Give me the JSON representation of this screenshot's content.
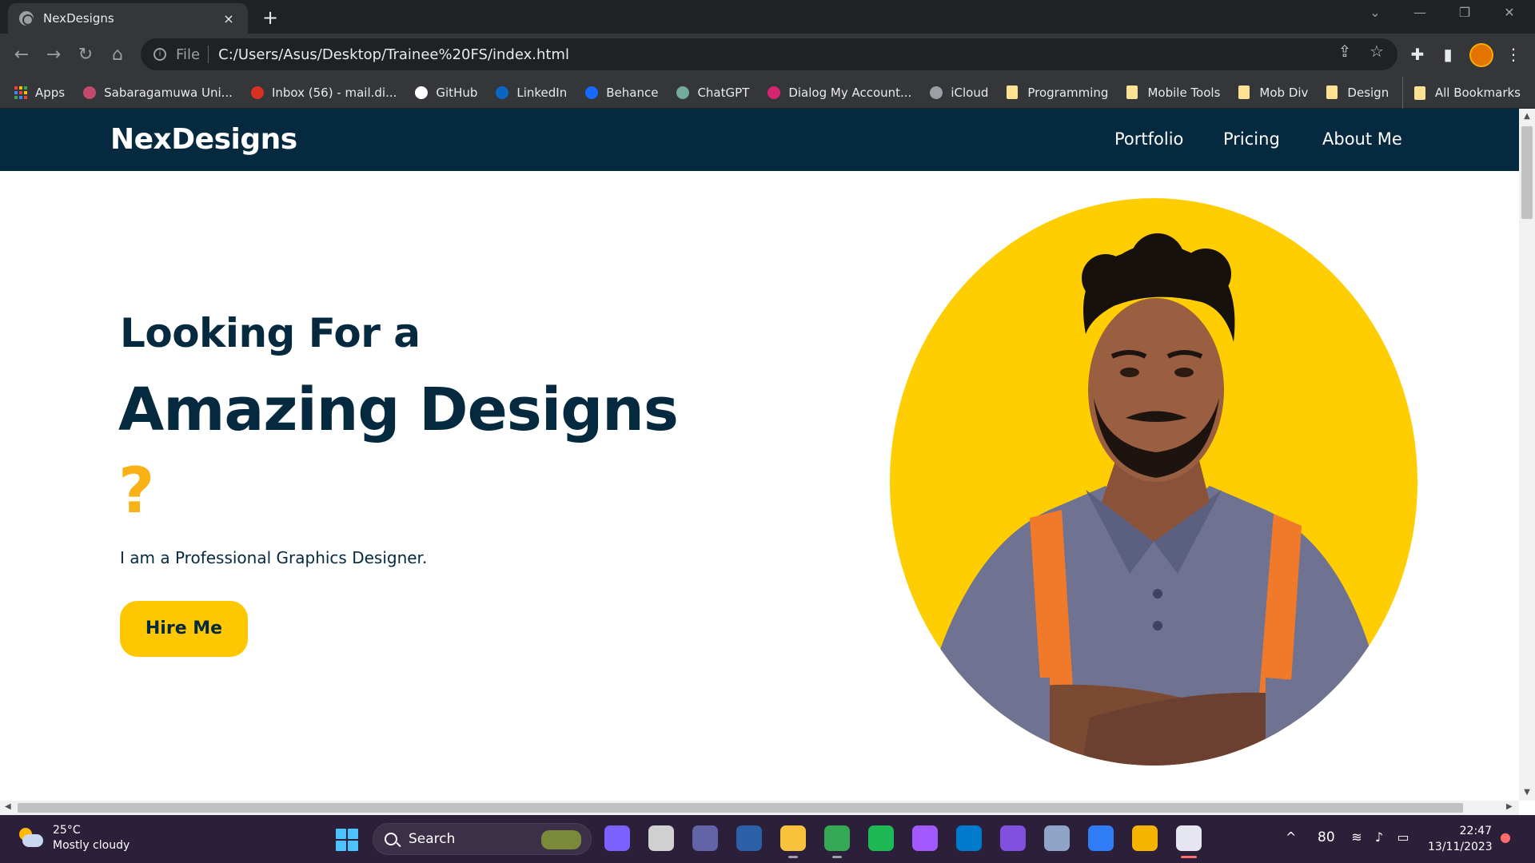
{
  "browser": {
    "tab_title": "NexDesigns",
    "tab_close": "×",
    "new_tab": "+",
    "address_scheme": "File",
    "address": "C:/Users/Asus/Desktop/Trainee%20FS/index.html",
    "bookmarks": [
      {
        "label": "Apps",
        "color": "#ea4335",
        "kind": "apps"
      },
      {
        "label": "Sabaragamuwa Uni...",
        "color": "#c24a6a",
        "kind": "icon"
      },
      {
        "label": "Inbox (56) - mail.di...",
        "color": "#d93025",
        "kind": "icon"
      },
      {
        "label": "GitHub",
        "color": "#ffffff",
        "kind": "icon"
      },
      {
        "label": "LinkedIn",
        "color": "#0a66c2",
        "kind": "icon"
      },
      {
        "label": "Behance",
        "color": "#1769ff",
        "kind": "icon"
      },
      {
        "label": "ChatGPT",
        "color": "#74aa9c",
        "kind": "icon"
      },
      {
        "label": "Dialog My Account...",
        "color": "#d6246e",
        "kind": "icon"
      },
      {
        "label": "iCloud",
        "color": "#9aa0a6",
        "kind": "icon"
      },
      {
        "label": "Programming",
        "color": "#fde293",
        "kind": "folder"
      },
      {
        "label": "Mobile Tools",
        "color": "#fde293",
        "kind": "folder"
      },
      {
        "label": "Mob Div",
        "color": "#fde293",
        "kind": "folder"
      },
      {
        "label": "Design",
        "color": "#fde293",
        "kind": "folder"
      }
    ],
    "all_bookmarks": "All Bookmarks"
  },
  "site": {
    "brand": "NexDesigns",
    "nav": {
      "portfolio": "Portfolio",
      "pricing": "Pricing",
      "about": "About Me"
    },
    "hero": {
      "line1": "Looking For a",
      "line2": "Amazing Designs",
      "question": "?",
      "subtitle": "I am a Professional Graphics Designer.",
      "cta": "Hire Me"
    },
    "colors": {
      "navy": "#05293f",
      "yellow": "#fecd02",
      "question": "#f9b115"
    }
  },
  "taskbar": {
    "weather_temp": "25°C",
    "weather_desc": "Mostly cloudy",
    "search_label": "Search",
    "tray_number": "80",
    "time": "22:47",
    "date": "13/11/2023",
    "apps": [
      {
        "name": "copilot-icon",
        "color": "#7b61ff"
      },
      {
        "name": "task-view-icon",
        "color": "#d0d0d0"
      },
      {
        "name": "teams-icon",
        "color": "#6264a7"
      },
      {
        "name": "powershell-icon",
        "color": "#2b5fa8"
      },
      {
        "name": "file-explorer-icon",
        "color": "#f9c23c"
      },
      {
        "name": "chrome-icon",
        "color": "#34a853"
      },
      {
        "name": "spotify-icon",
        "color": "#1db954"
      },
      {
        "name": "figma-icon",
        "color": "#a259ff"
      },
      {
        "name": "vscode-icon",
        "color": "#007acc"
      },
      {
        "name": "github-desktop-icon",
        "color": "#8250df"
      },
      {
        "name": "chart-app-icon",
        "color": "#90a4c8"
      },
      {
        "name": "app-store-icon",
        "color": "#2f7cf6"
      },
      {
        "name": "colorful-app-icon",
        "color": "#f4b400"
      },
      {
        "name": "snipping-tool-icon",
        "color": "#e6e6f0"
      }
    ]
  }
}
